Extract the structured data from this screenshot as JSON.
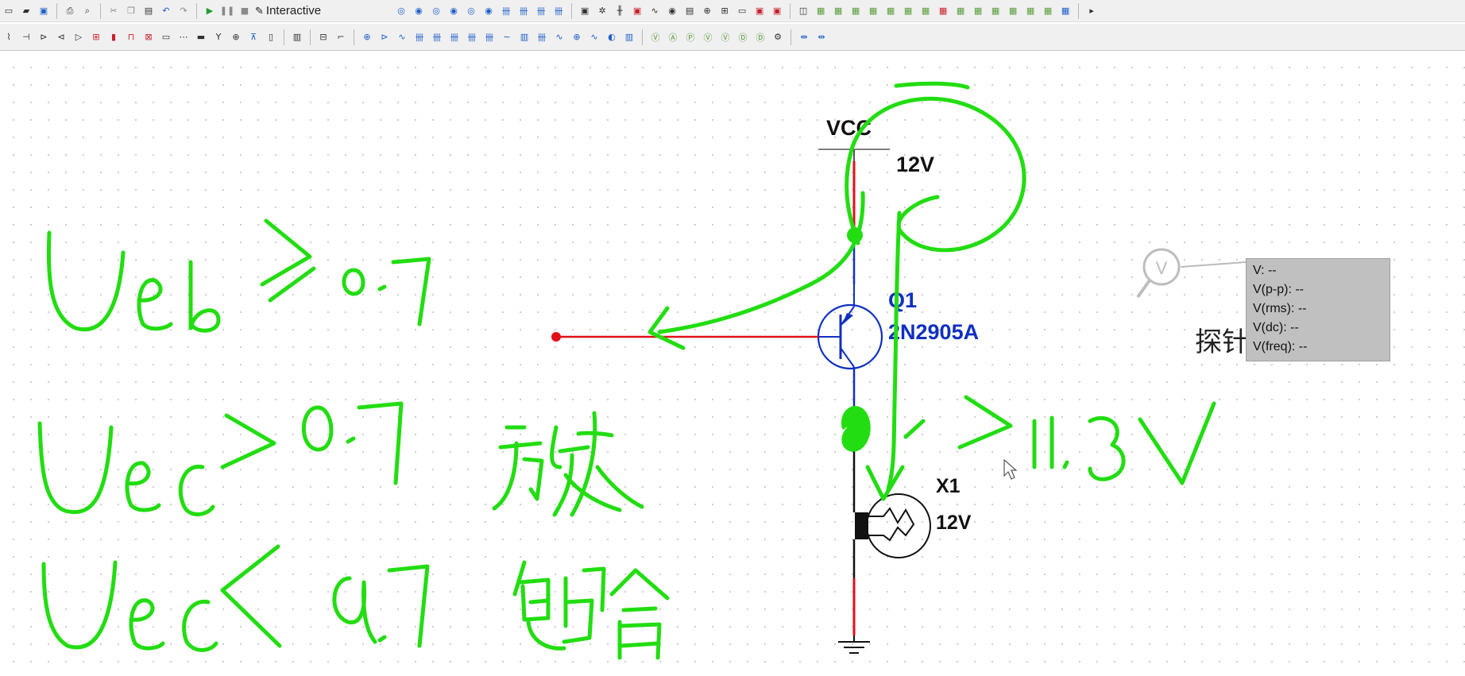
{
  "toolbar": {
    "simulation_mode_label": "Interactive"
  },
  "schematic": {
    "vcc": {
      "name": "VCC",
      "voltage": "12V"
    },
    "transistor": {
      "ref": "Q1",
      "model": "2N2905A"
    },
    "lamp": {
      "ref": "X1",
      "rating": "12V"
    }
  },
  "probe": {
    "label": "探针",
    "readings": [
      "V: --",
      "V(p-p): --",
      "V(rms): --",
      "V(dc): --",
      "V(freq): --"
    ]
  },
  "colors": {
    "wire_red": "#e0101a",
    "component_blue": "#1030c0",
    "annotation_green": "#22dd11",
    "toolbar_bg": "#f0f0f0"
  }
}
